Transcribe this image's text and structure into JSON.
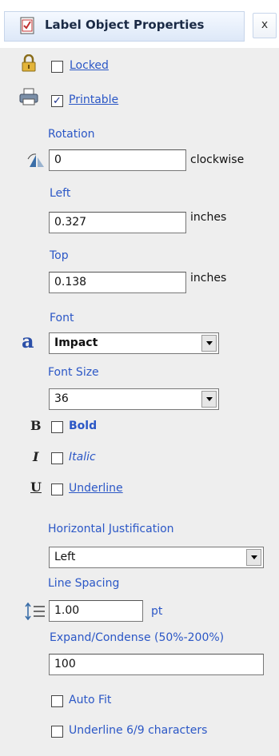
{
  "panel": {
    "title": "Label Object Properties",
    "close_label": "x"
  },
  "locked": {
    "label": "Locked",
    "checked": false
  },
  "printable": {
    "label": "Printable",
    "checked": true
  },
  "rotation": {
    "label": "Rotation",
    "value": "0",
    "unit": "clockwise"
  },
  "left": {
    "label": "Left",
    "value": "0.327",
    "unit": "inches"
  },
  "top": {
    "label": "Top",
    "value": "0.138",
    "unit": "inches"
  },
  "font": {
    "label": "Font",
    "value": "Impact",
    "icon_glyph": "a"
  },
  "font_size": {
    "label": "Font Size",
    "value": "36"
  },
  "bold": {
    "label": "Bold",
    "icon_glyph": "B",
    "checked": false
  },
  "italic": {
    "label": "Italic",
    "icon_glyph": "I",
    "checked": false
  },
  "underline": {
    "label": "Underline",
    "icon_glyph": "U",
    "checked": false
  },
  "h_justification": {
    "label": "Horizontal Justification",
    "value": "Left"
  },
  "line_spacing": {
    "label": "Line Spacing",
    "value": "1.00",
    "unit": "pt"
  },
  "expand_condense": {
    "label": "Expand/Condense (50%-200%)",
    "value": "100"
  },
  "auto_fit": {
    "label": "Auto Fit",
    "checked": false
  },
  "underline_69": {
    "label": "Underline 6/9 characters",
    "checked": false
  },
  "colors": {
    "label_blue": "#2b57c6",
    "panel_bg": "#eeeeee"
  }
}
